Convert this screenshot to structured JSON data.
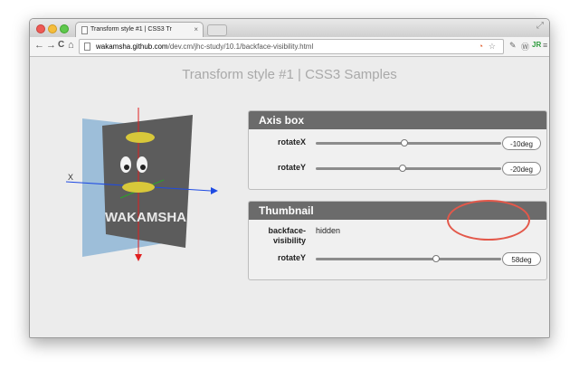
{
  "browser": {
    "tab_title": "Transform style #1 | CSS3 Tr",
    "tab_close": "×",
    "url_host": "wakamsha.github.com",
    "url_path": "/dev.cm/jhc-study/10.1/backface-visibility.html",
    "nav": {
      "back": "←",
      "forward": "→",
      "reload": "C",
      "home": "⌂"
    },
    "toolbar_icons": [
      "rss-icon",
      "star-icon",
      "brush-icon",
      "wordpress-icon",
      "jr-icon",
      "window-icon",
      "menu-icon"
    ]
  },
  "page": {
    "title": "Transform style #1 | CSS3 Samples",
    "scene": {
      "logo_text": "WAKAMSHA",
      "x_axis_label": "X"
    },
    "axis_box": {
      "header": "Axis box",
      "rows": [
        {
          "label": "rotateX",
          "value": "-10deg",
          "fraction": 0.48
        },
        {
          "label": "rotateY",
          "value": "-20deg",
          "fraction": 0.47
        }
      ]
    },
    "thumbnail": {
      "header": "Thumbnail",
      "backface_label": "backface-visibility",
      "backface_value": "hidden",
      "rotate_label": "rotateY",
      "rotate_value": "58deg",
      "rotate_fraction": 0.65
    }
  },
  "colors": {
    "panel_header": "#6b6b6b",
    "highlight": "#e3584a",
    "axis_x": "#1f4be3",
    "axis_y": "#e01f1f"
  }
}
